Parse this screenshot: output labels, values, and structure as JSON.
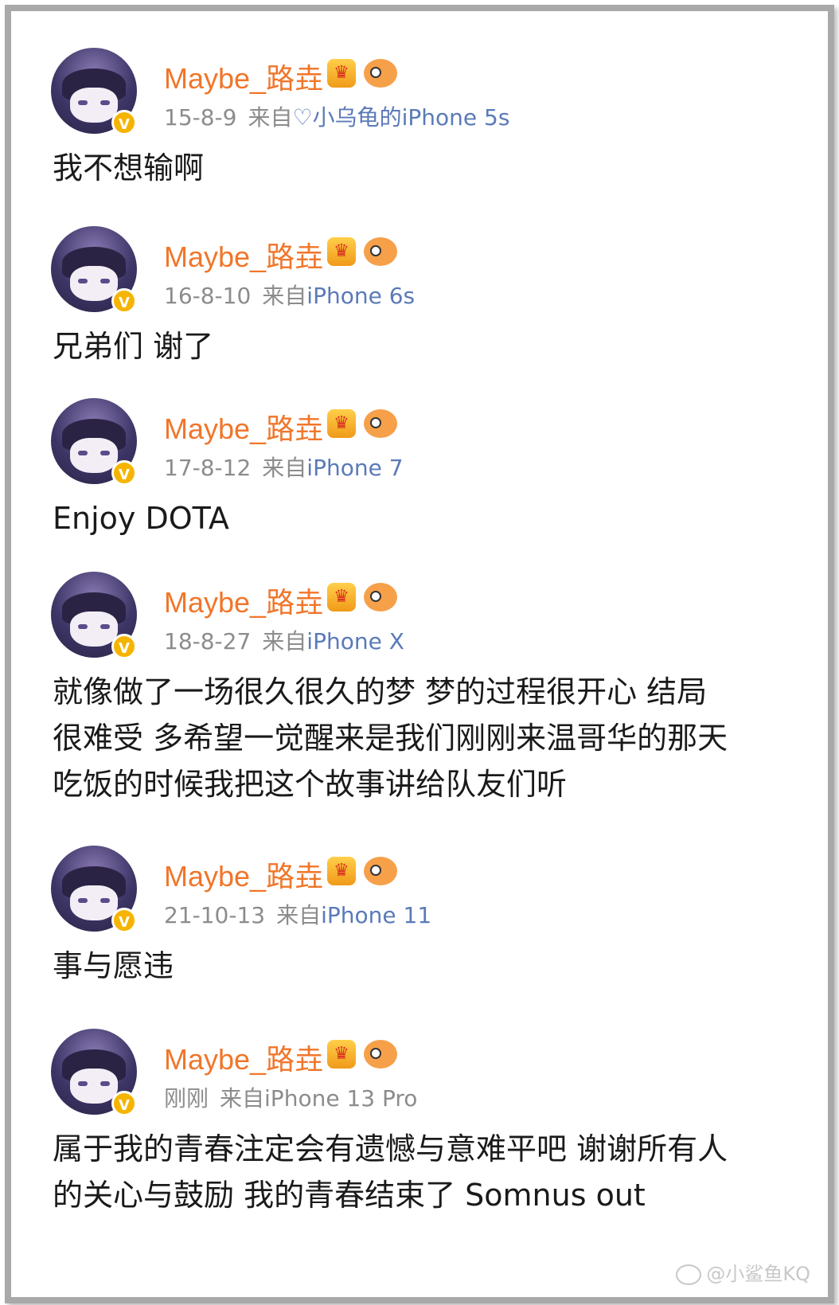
{
  "posts": [
    {
      "username": "Maybe_路垚",
      "date": "15-8-9",
      "from": "来自",
      "device": "♡小乌龟的iPhone 5s",
      "text": "我不想输啊"
    },
    {
      "username": "Maybe_路垚",
      "date": "16-8-10",
      "from": "来自",
      "device": "iPhone 6s",
      "text": "兄弟们 谢了"
    },
    {
      "username": "Maybe_路垚",
      "date": "17-8-12",
      "from": "来自",
      "device": "iPhone 7",
      "text": "Enjoy DOTA"
    },
    {
      "username": "Maybe_路垚",
      "date": "18-8-27",
      "from": "来自",
      "device": "iPhone X",
      "text_lines": [
        "就像做了一场很久很久的梦 梦的过程很开心 结局",
        "很难受 多希望一觉醒来是我们刚刚来温哥华的那天",
        "吃饭的时候我把这个故事讲给队友们听"
      ]
    },
    {
      "username": "Maybe_路垚",
      "date": "21-10-13",
      "from": "来自",
      "device": "iPhone 11",
      "text": "事与愿违"
    },
    {
      "username": "Maybe_路垚",
      "date": "刚刚",
      "from": "来自",
      "device": "iPhone 13 Pro",
      "text_lines": [
        "属于我的青春注定会有遗憾与意难平吧 谢谢所有人",
        "的关心与鼓励 我的青春结束了 Somnus out"
      ]
    }
  ],
  "verified_badge": "V",
  "watermark": "@小鲨鱼KQ",
  "icons": [
    "avatar",
    "verified-badge",
    "crown-badge-icon",
    "fish-badge-icon",
    "weibo-logo-icon"
  ],
  "colors": {
    "username": "#f0762a",
    "device_link": "#5a7ab8",
    "meta": "#8c8c8c",
    "frame": "#a9a9a9",
    "verified": "#f5b400"
  }
}
